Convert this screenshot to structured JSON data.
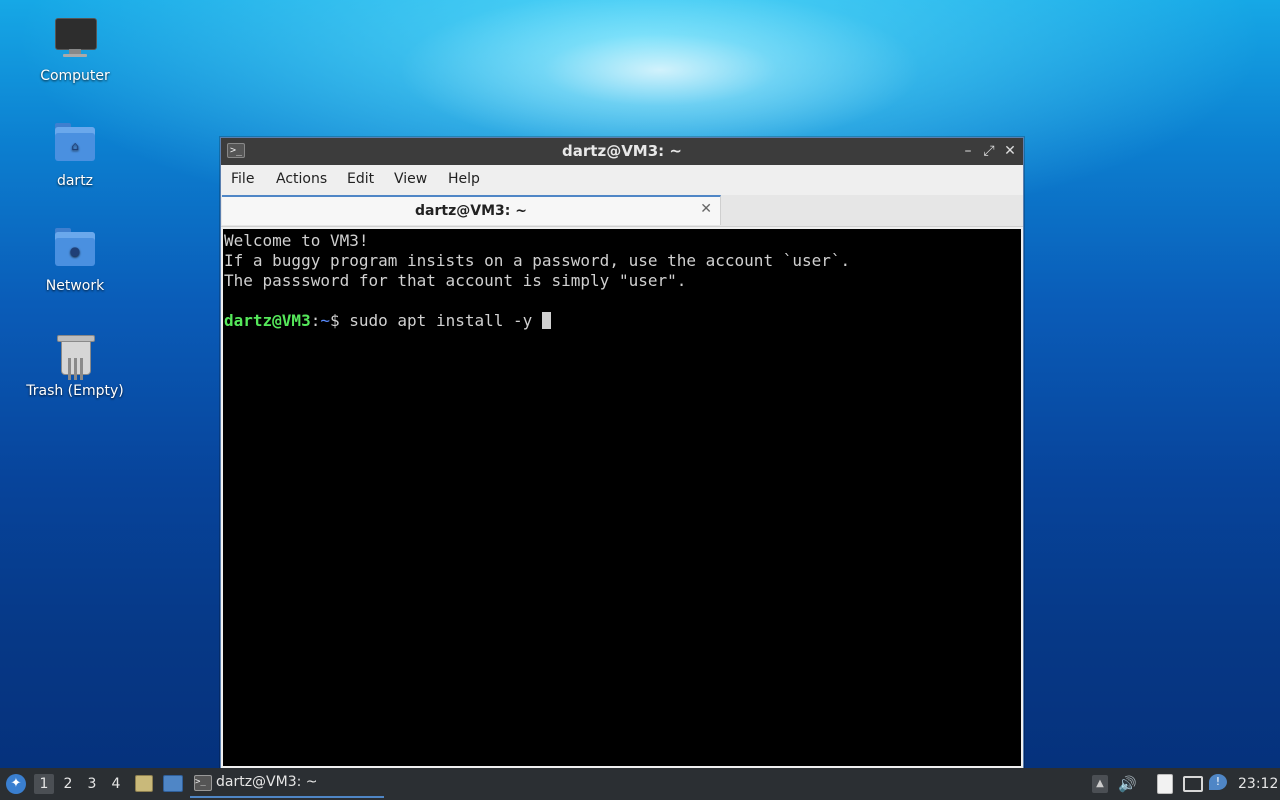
{
  "desktop": {
    "icons": [
      {
        "label": "Computer"
      },
      {
        "label": "dartz"
      },
      {
        "label": "Network"
      },
      {
        "label": "Trash (Empty)"
      }
    ]
  },
  "window": {
    "title": "dartz@VM3: ~",
    "controls": {
      "minimize": "–",
      "maximize": "⤢",
      "close": "✕"
    },
    "menu": [
      "File",
      "Actions",
      "Edit",
      "View",
      "Help"
    ],
    "tab": {
      "label": "dartz@VM3: ~",
      "close": "✕"
    }
  },
  "terminal": {
    "lines": [
      "Welcome to VM3!",
      "If a buggy program insists on a password, use the account `user`.",
      "The passsword for that account is simply \"user\"."
    ],
    "prompt_user": "dartz@VM3",
    "prompt_sep": ":",
    "prompt_path": "~",
    "prompt_symbol": "$ ",
    "command": "sudo apt install -y "
  },
  "taskbar": {
    "workspaces": [
      "1",
      "2",
      "3",
      "4"
    ],
    "active_workspace": "1",
    "task_label": "dartz@VM3: ~",
    "clock": "23:12"
  },
  "colors": {
    "prompt_user": "#55e85a",
    "prompt_path": "#5a8cff",
    "accent": "#4f86c6"
  }
}
